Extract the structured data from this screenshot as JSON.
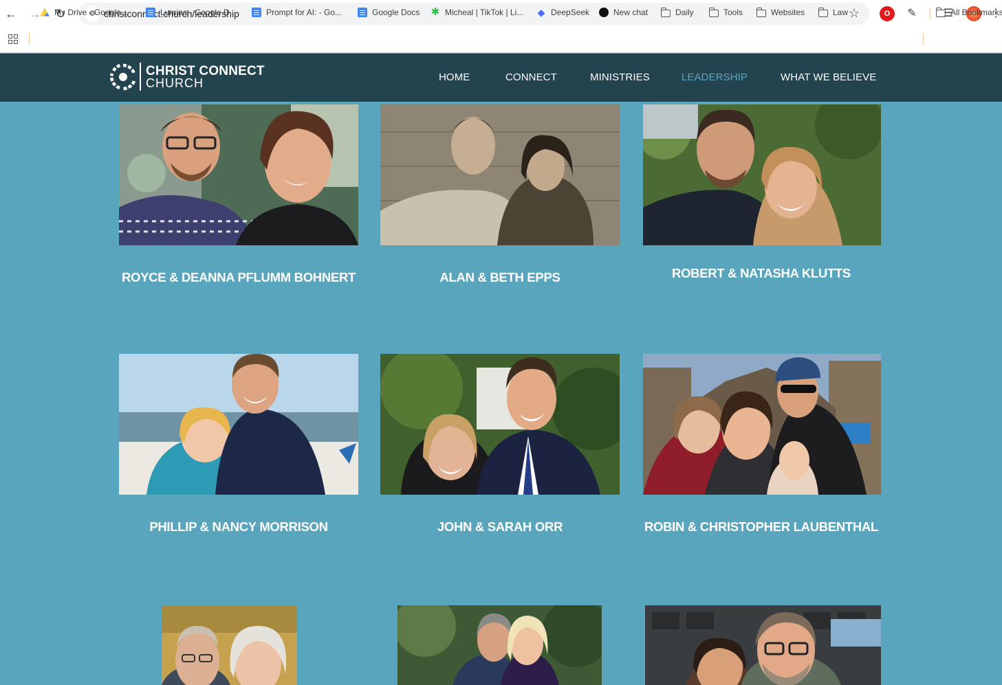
{
  "browser": {
    "url": "christconnect.church/leadership",
    "bookmarks": [
      {
        "label": "My Drive - Google...",
        "icon": "google-drive-icon"
      },
      {
        "label": "Lumina - Google D...",
        "icon": "google-docs-icon"
      },
      {
        "label": "Prompt for AI: - Go...",
        "icon": "google-docs-icon"
      },
      {
        "label": "Google Docs",
        "icon": "google-docs-icon"
      },
      {
        "label": "Micheal | TikTok | Li...",
        "icon": "sparkle-icon"
      },
      {
        "label": "DeepSeek",
        "icon": "deepseek-icon"
      },
      {
        "label": "New chat",
        "icon": "chat-icon"
      },
      {
        "label": "Daily",
        "icon": "folder-icon"
      },
      {
        "label": "Tools",
        "icon": "folder-icon"
      },
      {
        "label": "Websites",
        "icon": "folder-icon"
      },
      {
        "label": "Law",
        "icon": "folder-icon"
      }
    ],
    "all_bookmarks": "All Bookmarks"
  },
  "site": {
    "logo_line1": "CHRIST CONNECT",
    "logo_line2": "CHURCH",
    "nav": [
      {
        "label": "HOME",
        "active": false
      },
      {
        "label": "CONNECT",
        "active": false
      },
      {
        "label": "MINISTRIES",
        "active": false
      },
      {
        "label": "LEADERSHIP",
        "active": true
      },
      {
        "label": "WHAT WE BELIEVE",
        "active": false
      }
    ],
    "accent_color": "#5aa5be",
    "header_color": "#23434f"
  },
  "leaders": [
    {
      "name": "ROYCE & DEANNA PFLUMM BOHNERT",
      "photo": "couple-smiling-photo"
    },
    {
      "name": "ALAN & BETH EPPS",
      "photo": "sepia-couple-photo"
    },
    {
      "name": "ROBERT & NATASHA KLUTTS",
      "photo": "couple-outdoors-photo"
    },
    {
      "name": "PHILLIP & NANCY MORRISON",
      "photo": "beach-couple-photo"
    },
    {
      "name": "JOHN & SARAH ORR",
      "photo": "couple-garden-photo"
    },
    {
      "name": "ROBIN & CHRISTOPHER LAUBENTHAL",
      "photo": "family-castle-photo"
    },
    {
      "name": "",
      "photo": "older-couple-photo"
    },
    {
      "name": "",
      "photo": "couple-forest-photo"
    },
    {
      "name": "",
      "photo": "couple-stadium-photo"
    }
  ]
}
